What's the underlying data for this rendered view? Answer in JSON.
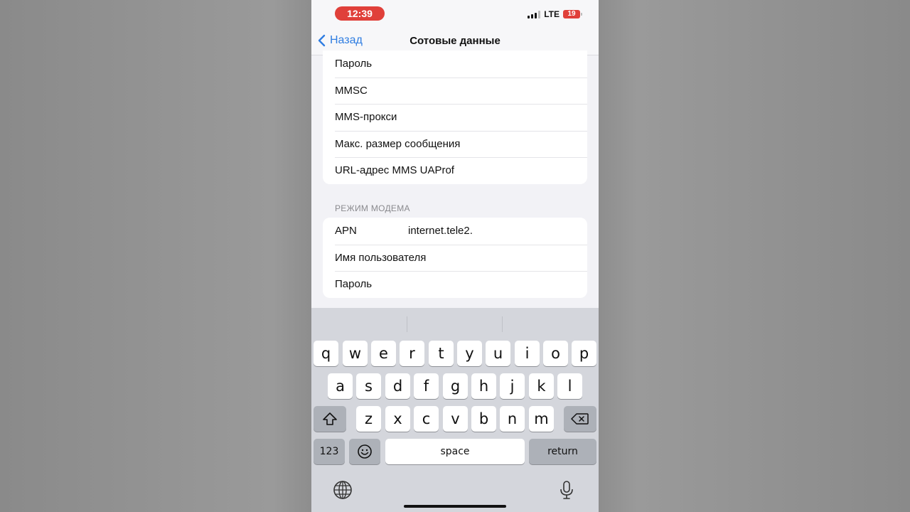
{
  "status": {
    "time": "12:39",
    "network": "LTE",
    "battery": "19"
  },
  "nav": {
    "back_label": "Назад",
    "title": "Сотовые данные"
  },
  "mms_section": {
    "rows": [
      "Пароль",
      "MMSC",
      "MMS-прокси",
      "Макс. размер сообщения",
      "URL-адрес MMS UAProf"
    ]
  },
  "modem_section": {
    "header": "РЕЖИМ МОДЕМА",
    "apn_label": "APN",
    "apn_value": "internet.tele2.",
    "username_label": "Имя пользователя",
    "password_label": "Пароль"
  },
  "keyboard": {
    "row1": [
      "q",
      "w",
      "e",
      "r",
      "t",
      "y",
      "u",
      "i",
      "o",
      "p"
    ],
    "row2": [
      "a",
      "s",
      "d",
      "f",
      "g",
      "h",
      "j",
      "k",
      "l"
    ],
    "row3": [
      "z",
      "x",
      "c",
      "v",
      "b",
      "n",
      "m"
    ],
    "numbers_label": "123",
    "space_label": "space",
    "return_label": "return",
    "icons": {
      "shift": "shift-icon",
      "delete": "backspace-icon",
      "emoji": "emoji-icon",
      "globe": "globe-icon",
      "mic": "microphone-icon"
    }
  },
  "colors": {
    "accent": "#2f7de1",
    "time_pill": "#e0403a",
    "battery": "#e0403a"
  }
}
